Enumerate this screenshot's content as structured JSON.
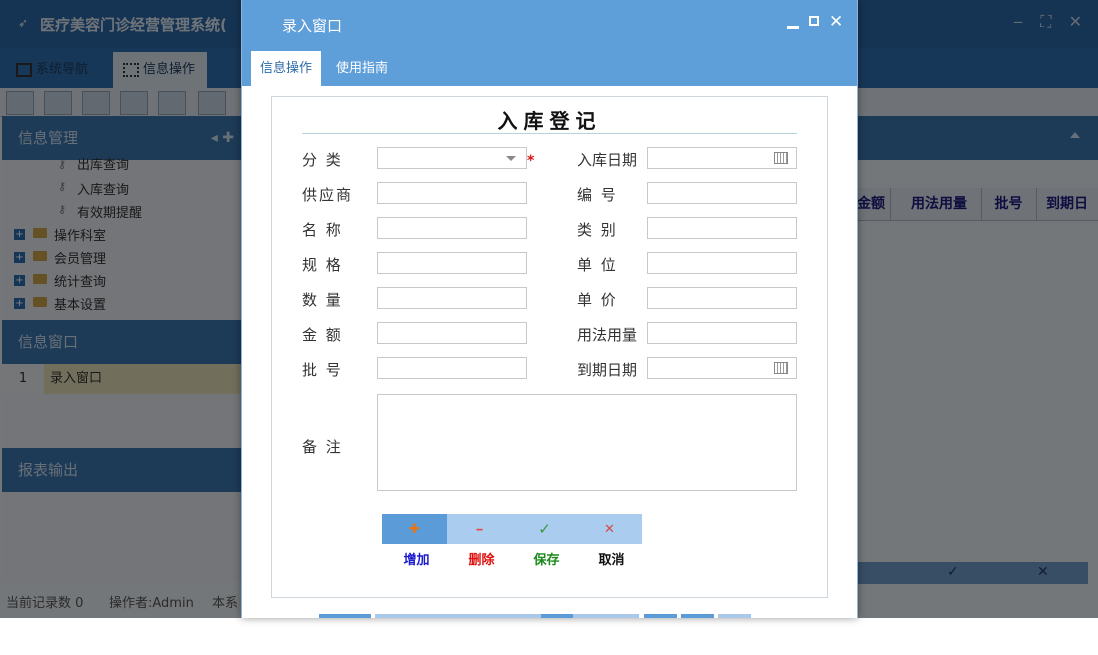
{
  "app": {
    "title": "医疗美容门诊经营管理系统(",
    "tabs": [
      "系统导航",
      "信息操作"
    ],
    "left_panel": {
      "header": "信息管理",
      "tree": [
        {
          "label": "出库查询",
          "type": "leaf"
        },
        {
          "label": "入库查询",
          "type": "leaf"
        },
        {
          "label": "有效期提醒",
          "type": "leaf"
        },
        {
          "label": "操作科室",
          "type": "folder"
        },
        {
          "label": "会员管理",
          "type": "folder"
        },
        {
          "label": "统计查询",
          "type": "folder"
        },
        {
          "label": "基本设置",
          "type": "folder"
        }
      ],
      "window_header": "信息窗口",
      "window_rows": [
        {
          "num": "1",
          "label": "录入窗口"
        }
      ],
      "report_header": "报表输出"
    },
    "grid_columns": [
      "金额",
      "用法用量",
      "批号",
      "到期日"
    ],
    "status": {
      "record_count": "当前记录数 0",
      "operator": "操作者:Admin",
      "extra": "本系"
    }
  },
  "modal": {
    "title": "录入窗口",
    "tabs": [
      "信息操作",
      "使用指南"
    ],
    "form_title": "入库登记",
    "fields_left": [
      {
        "label": "分 类",
        "kind": "select",
        "value": ""
      },
      {
        "label": "供应商",
        "kind": "text",
        "value": ""
      },
      {
        "label": "名 称",
        "kind": "text",
        "value": ""
      },
      {
        "label": "规 格",
        "kind": "text",
        "value": ""
      },
      {
        "label": "数 量",
        "kind": "text",
        "value": ""
      },
      {
        "label": "金 额",
        "kind": "text",
        "value": ""
      },
      {
        "label": "批 号",
        "kind": "text",
        "value": ""
      }
    ],
    "fields_right": [
      {
        "label": "入库日期",
        "kind": "date",
        "value": ""
      },
      {
        "label": "编 号",
        "kind": "text",
        "value": ""
      },
      {
        "label": "类 别",
        "kind": "text",
        "value": ""
      },
      {
        "label": "单 位",
        "kind": "text",
        "value": ""
      },
      {
        "label": "单 价",
        "kind": "text",
        "value": ""
      },
      {
        "label": "用法用量",
        "kind": "text",
        "value": ""
      },
      {
        "label": "到期日期",
        "kind": "date",
        "value": ""
      }
    ],
    "remark_label": "备 注",
    "remark_value": "",
    "required_mark": "*",
    "actions": [
      {
        "label": "增加",
        "icon": "plus-icon",
        "symbol": "✚",
        "color": "#1a1ad0",
        "icon_color": "#e8730f"
      },
      {
        "label": "删除",
        "icon": "minus-icon",
        "symbol": "━",
        "color": "#e01010",
        "icon_color": "#e84a4a"
      },
      {
        "label": "保存",
        "icon": "check-icon",
        "symbol": "✓",
        "color": "#1b8a1b",
        "icon_color": "#3a9a3a"
      },
      {
        "label": "取消",
        "icon": "x-icon",
        "symbol": "✕",
        "color": "#111111",
        "icon_color": "#d84a4a"
      }
    ]
  }
}
